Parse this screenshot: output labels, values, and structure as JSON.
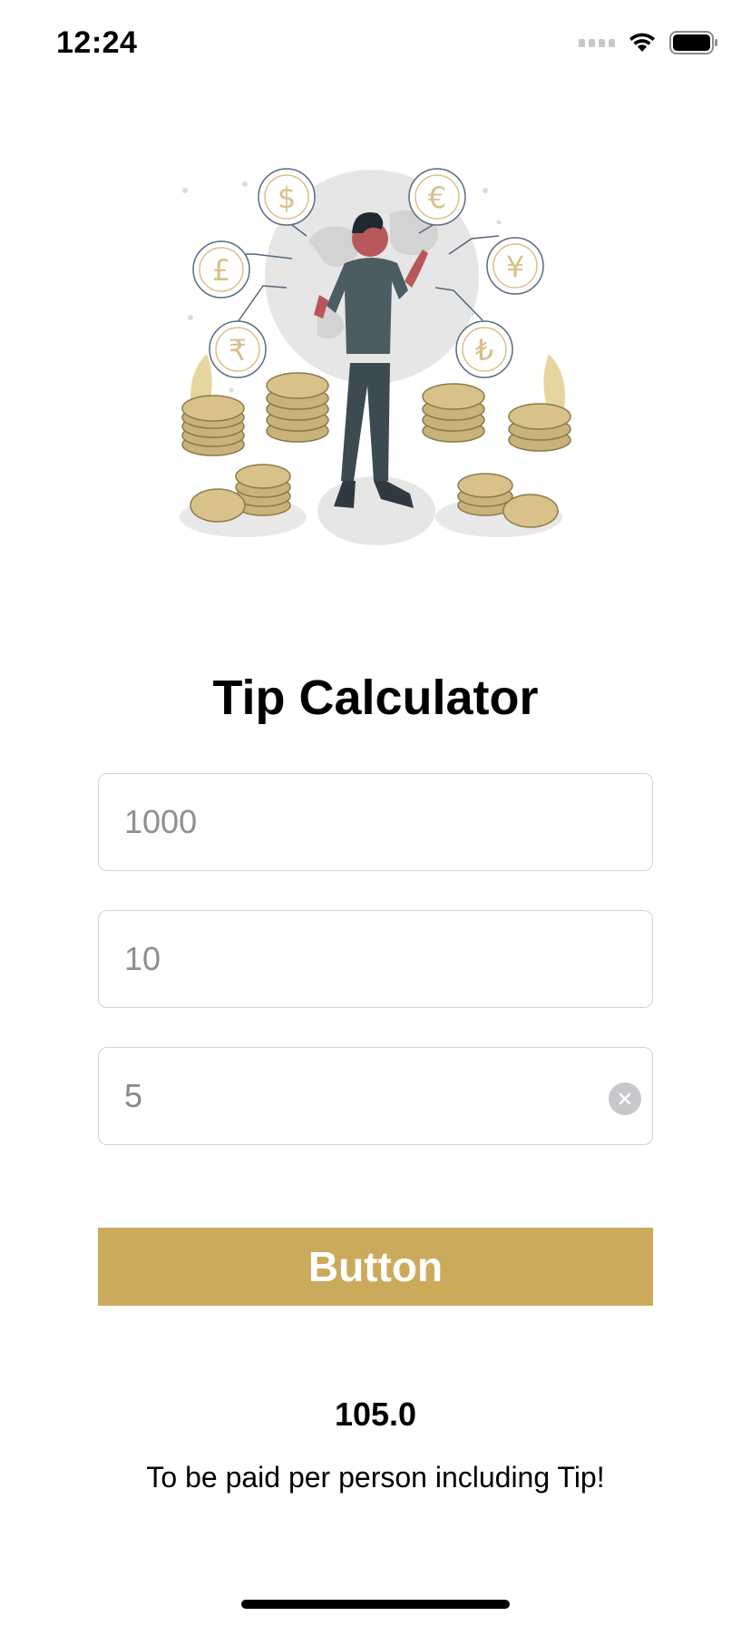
{
  "status_bar": {
    "time": "12:24",
    "icons": [
      "cellular-signal-icon",
      "wifi-icon",
      "battery-icon"
    ]
  },
  "illustration": {
    "description_icons": [
      "dollar-coin-icon",
      "euro-coin-icon",
      "pound-coin-icon",
      "yen-coin-icon",
      "rupee-coin-icon",
      "lira-coin-icon"
    ]
  },
  "title": "Tip Calculator",
  "inputs": {
    "bill_amount": {
      "value": "",
      "placeholder": "1000"
    },
    "tip_percent": {
      "value": "",
      "placeholder": "10"
    },
    "people_count": {
      "value": "5",
      "placeholder": ""
    }
  },
  "button": {
    "label": "Button"
  },
  "result": {
    "value": "105.0",
    "caption": "To be paid per person including Tip!"
  },
  "colors": {
    "accent": "#cbaa5b",
    "background": "#ffffff",
    "field_border": "#d1d1d6",
    "placeholder": "#8e8e93"
  }
}
